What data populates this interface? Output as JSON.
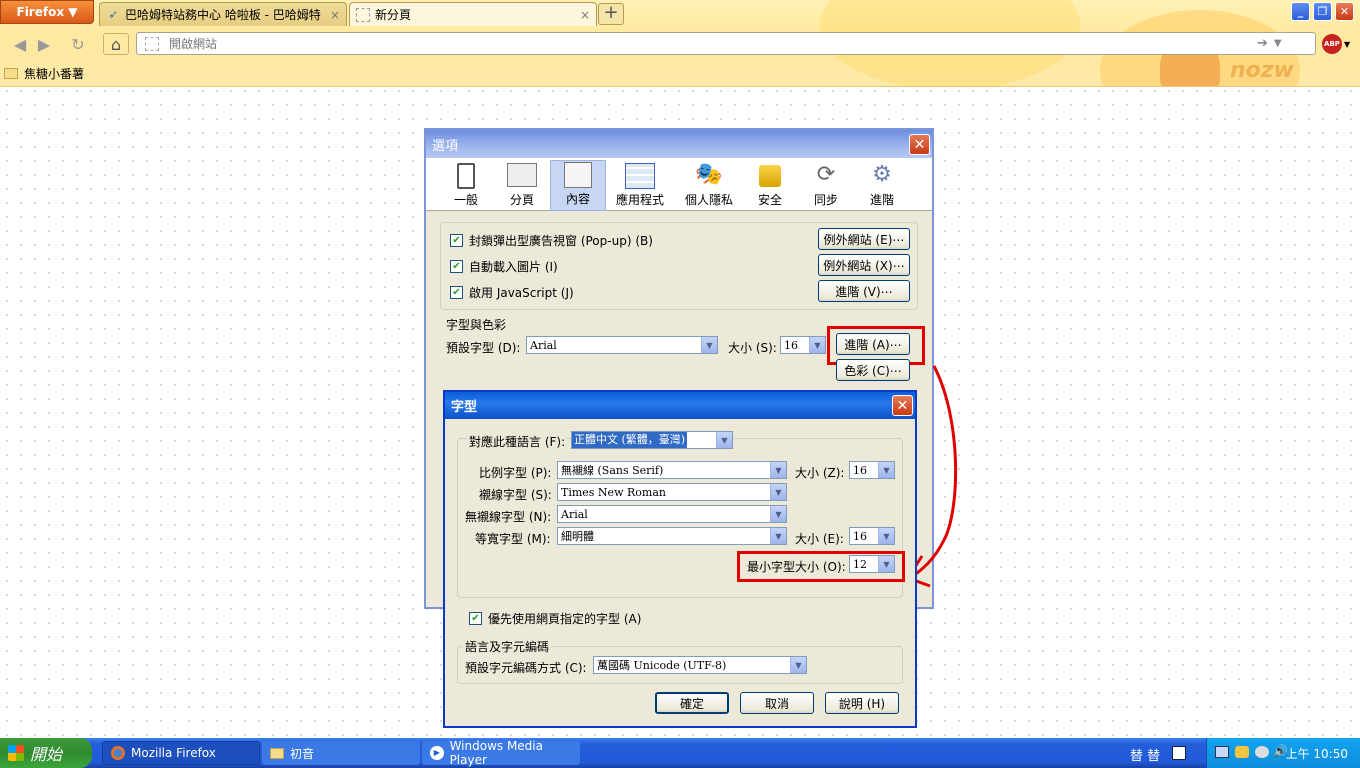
{
  "browser": {
    "menu_button": "Firefox ▼",
    "tabs": [
      {
        "title": "巴哈姆特站務中心 哈啦板 - 巴哈姆特",
        "close": "×"
      },
      {
        "title": "新分頁",
        "close": "×"
      }
    ],
    "new_tab": "+",
    "url_placeholder": "開啟網站",
    "bookmark": "焦糖小番薯",
    "window_controls": [
      "_",
      "❐",
      "✕"
    ],
    "abp_label": "ABP",
    "theme_text": "nozw"
  },
  "options_dialog": {
    "title": "選項",
    "close": "✕",
    "panes": [
      {
        "label": "一般",
        "icon": "general-icon"
      },
      {
        "label": "分頁",
        "icon": "tabs-icon"
      },
      {
        "label": "內容",
        "icon": "content-icon",
        "selected": true
      },
      {
        "label": "應用程式",
        "icon": "applications-icon"
      },
      {
        "label": "個人隱私",
        "icon": "privacy-icon"
      },
      {
        "label": "安全",
        "icon": "lock-icon"
      },
      {
        "label": "同步",
        "icon": "sync-icon"
      },
      {
        "label": "進階",
        "icon": "gear-icon"
      }
    ],
    "checks": [
      {
        "label": "封鎖彈出型廣告視窗 (Pop-up) (B)",
        "checked": true,
        "button": "例外網站 (E)⋯"
      },
      {
        "label": "自動載入圖片 (I)",
        "checked": true,
        "button": "例外網站 (X)⋯"
      },
      {
        "label": "啟用 JavaScript (J)",
        "checked": true,
        "button": "進階 (V)⋯"
      }
    ],
    "fonts_group": "字型與色彩",
    "default_font_label": "預設字型 (D):",
    "default_font_value": "Arial",
    "size_label": "大小 (S):",
    "size_value": "16",
    "advanced_button": "進階 (A)⋯",
    "colors_button": "色彩 (C)⋯"
  },
  "fonts_dialog": {
    "title": "字型",
    "close": "✕",
    "language_label": "對應此種語言 (F):",
    "language_value": "正體中文 (繁體，臺灣)",
    "proportional_label": "比例字型 (P):",
    "proportional_value": "無襯線 (Sans Serif)",
    "prop_size_label": "大小 (Z):",
    "prop_size_value": "16",
    "serif_label": "襯線字型 (S):",
    "serif_value": "Times New Roman",
    "sans_label": "無襯線字型 (N):",
    "sans_value": "Arial",
    "mono_label": "等寬字型 (M):",
    "mono_value": "細明體",
    "mono_size_label": "大小 (E):",
    "mono_size_value": "16",
    "min_size_label": "最小字型大小 (O):",
    "min_size_value": "12",
    "allow_pages_label": "優先使用網頁指定的字型 (A)",
    "allow_pages_checked": true,
    "encoding_group": "語言及字元編碼",
    "encoding_label": "預設字元編碼方式 (C):",
    "encoding_value": "萬國碼 Unicode (UTF-8)",
    "ok_button": "確定",
    "cancel_button": "取消",
    "help_button": "說明 (H)"
  },
  "taskbar": {
    "start": "開始",
    "tasks": [
      "Mozilla Firefox",
      "初音",
      "Windows Media Player"
    ],
    "lang_indicators": "替 替",
    "clock": "上午 10:50"
  },
  "colors": {
    "highlight_red": "#e00000",
    "xp_blue": "#245edb",
    "firefox_orange": "#e8721f"
  }
}
